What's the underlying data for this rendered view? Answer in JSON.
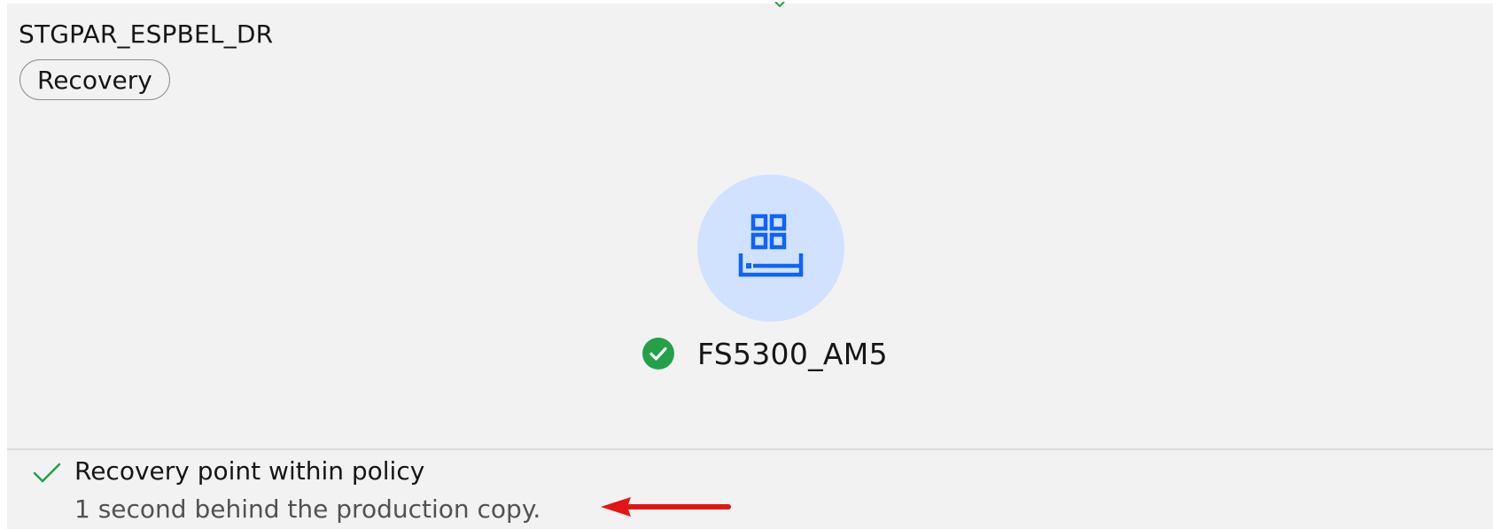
{
  "group": {
    "name": "STGPAR_ESPBEL_DR",
    "role_tag": "Recovery"
  },
  "system": {
    "icon": "storage-system-icon",
    "status_icon": "checkmark-filled-icon",
    "name": "FS5300_AM5"
  },
  "policy": {
    "icon": "checkmark-icon",
    "title": "Recovery point within policy",
    "detail": "1 second behind the production copy."
  },
  "annotation": {
    "icon": "arrow-left-icon"
  },
  "colors": {
    "background": "#f2f2f2",
    "circle": "#d0e2ff",
    "icon_blue": "#0f62fe",
    "success": "#24a148",
    "annotation_red": "#e51414"
  }
}
